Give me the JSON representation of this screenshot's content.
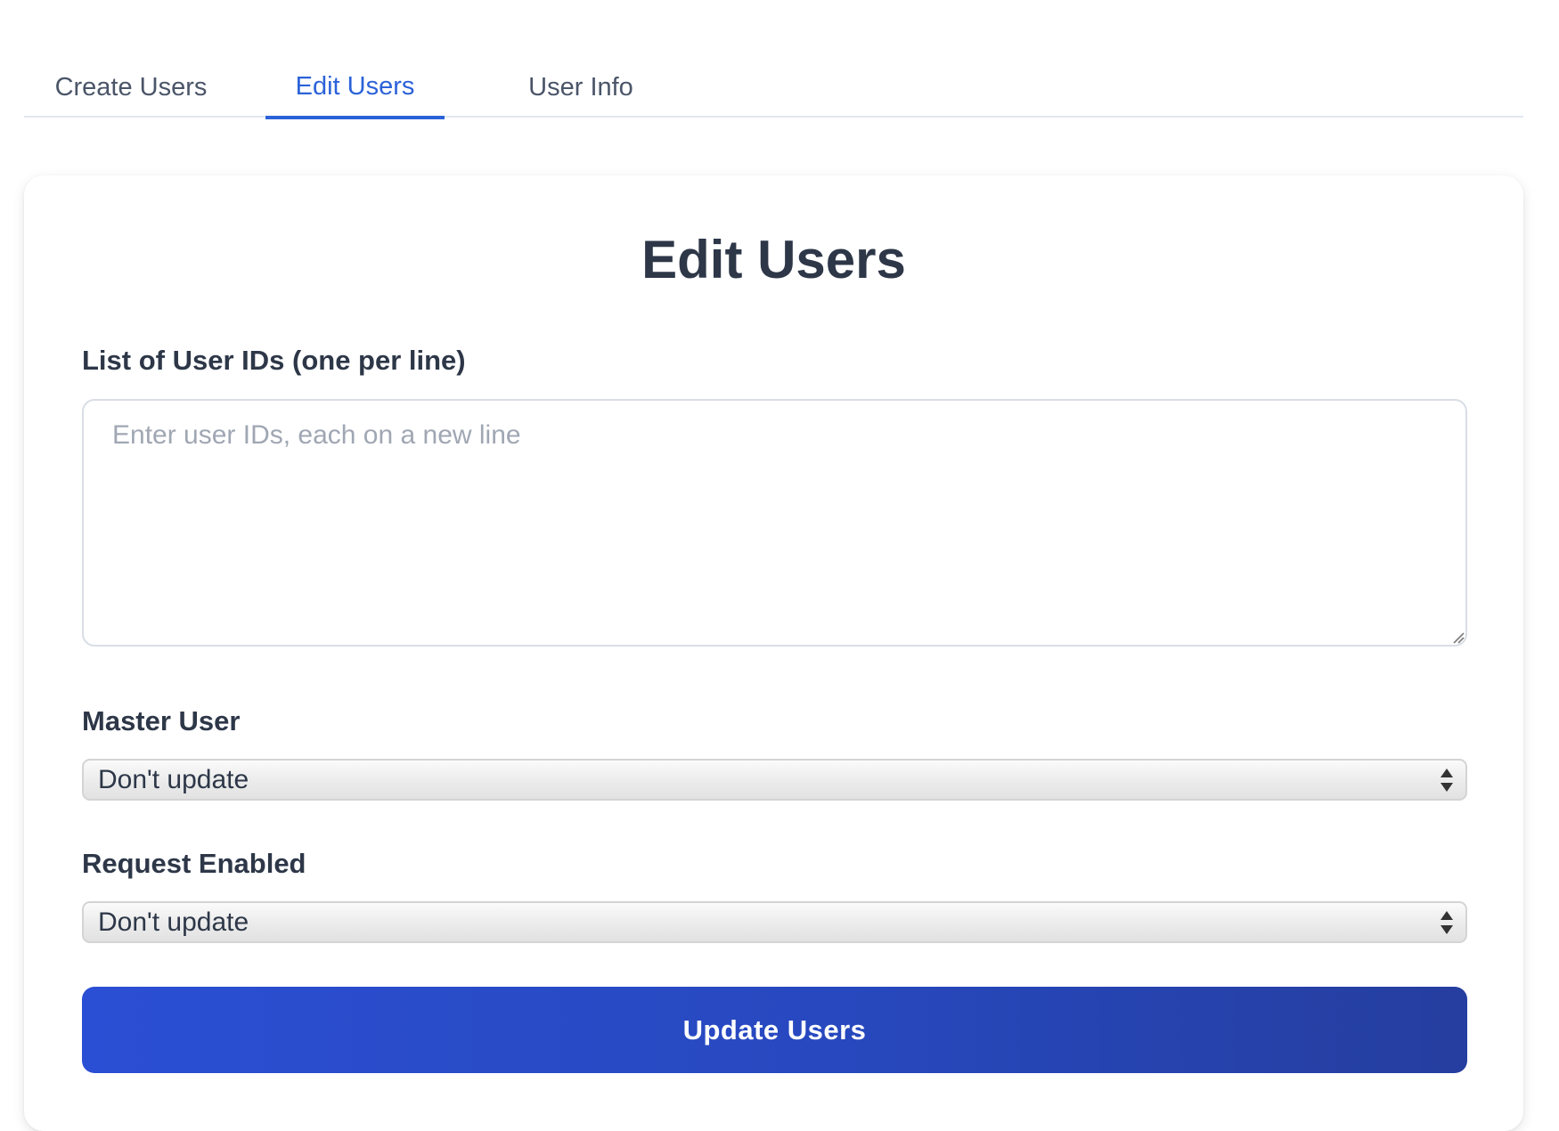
{
  "tabs": [
    {
      "label": "Create Users",
      "active": false
    },
    {
      "label": "Edit Users",
      "active": true
    },
    {
      "label": "User Info",
      "active": false
    }
  ],
  "colors": {
    "accent": "#2b62d9",
    "button_start": "#2b4fd4",
    "button_end": "#253e9f",
    "text": "#2d3748"
  },
  "form": {
    "title": "Edit Users",
    "user_ids": {
      "label": "List of User IDs (one per line)",
      "placeholder": "Enter user IDs, each on a new line",
      "value": ""
    },
    "master_user": {
      "label": "Master User",
      "value": "Don't update"
    },
    "request_enabled": {
      "label": "Request Enabled",
      "value": "Don't update"
    },
    "submit_label": "Update Users"
  },
  "icons": {
    "select_arrows": "chevron-up-down-icon",
    "resize": "resize-grip-icon"
  }
}
